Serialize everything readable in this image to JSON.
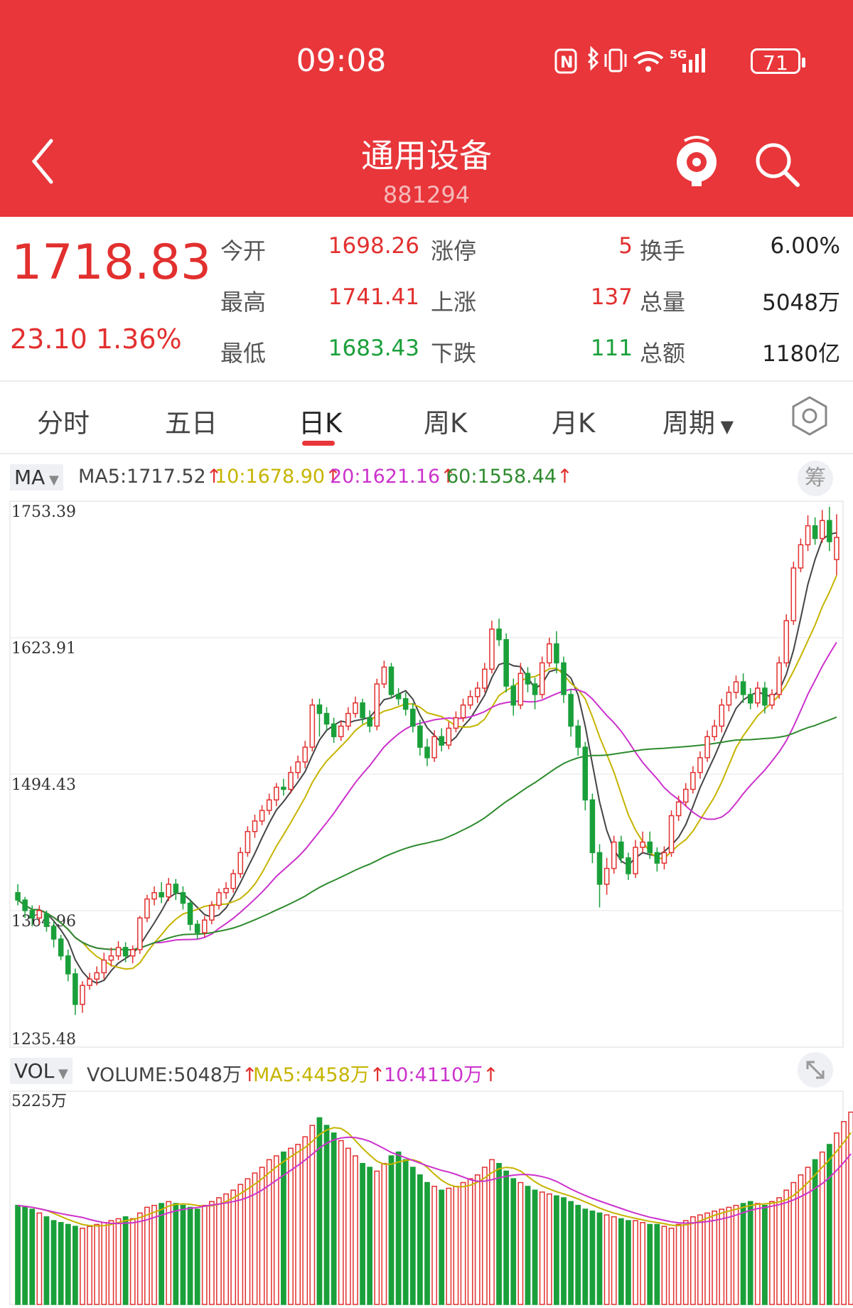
{
  "status_bar": {
    "time": "09:08",
    "network": "5G",
    "battery": "71"
  },
  "header": {
    "title": "通用设备",
    "code": "881294",
    "back_icon": "chevron-left-icon",
    "robot_icon": "robot-assistant-icon",
    "search_icon": "search-icon"
  },
  "quote": {
    "price": "1718.83",
    "change": "23.10",
    "change_pct": "1.36%",
    "rows": [
      {
        "l1": "今开",
        "v1": "1698.26",
        "l2": "涨停",
        "v2": "5",
        "l3": "换手",
        "v3": "6.00%"
      },
      {
        "l1": "最高",
        "v1": "1741.41",
        "l2": "上涨",
        "v2": "137",
        "l3": "总量",
        "v3": "5048万"
      },
      {
        "l1": "最低",
        "v1": "1683.43",
        "l2": "下跌",
        "v2": "111",
        "l3": "总额",
        "v3": "1180亿"
      }
    ]
  },
  "tabs": [
    {
      "label": "分时"
    },
    {
      "label": "五日"
    },
    {
      "label": "日K",
      "active": true
    },
    {
      "label": "周K"
    },
    {
      "label": "月K"
    },
    {
      "label": "周期"
    }
  ],
  "settings_icon": "hexagon-settings-icon",
  "ma_legend": {
    "selector": "MA",
    "items": [
      {
        "text": "MA5:1717.52",
        "color": "#444444"
      },
      {
        "text": "10:1678.90",
        "color": "#c6b400"
      },
      {
        "text": "20:1621.16",
        "color": "#cc33cc"
      },
      {
        "text": "60:1558.44",
        "color": "#2e8b2e"
      }
    ],
    "chou_label": "筹"
  },
  "vol_legend": {
    "selector": "VOL",
    "items": [
      {
        "text": "VOLUME:5048万",
        "color": "#444444"
      },
      {
        "text": "MA5:4458万",
        "color": "#c6b400"
      },
      {
        "text": "10:4110万",
        "color": "#cc33cc"
      }
    ],
    "expand_icon": "expand-icon"
  },
  "chart_data": {
    "type": "candlestick",
    "y_ticks": [
      "1753.39",
      "1623.91",
      "1494.43",
      "1364.96",
      "1235.48"
    ],
    "ylim": [
      1235.48,
      1753.39
    ],
    "volume_max_label": "5225万",
    "volume_max": 5225,
    "colors": {
      "up": "#e2302f",
      "down": "#1aa03a",
      "ma5": "#444444",
      "ma10": "#c6b400",
      "ma20": "#cc33cc",
      "ma60": "#2e8b2e"
    },
    "candles": [
      [
        1382,
        1375,
        1390,
        1370
      ],
      [
        1375,
        1365,
        1378,
        1358
      ],
      [
        1365,
        1358,
        1370,
        1350
      ],
      [
        1358,
        1365,
        1370,
        1352
      ],
      [
        1362,
        1350,
        1365,
        1345
      ],
      [
        1350,
        1338,
        1355,
        1330
      ],
      [
        1338,
        1322,
        1342,
        1318
      ],
      [
        1322,
        1305,
        1328,
        1298
      ],
      [
        1305,
        1276,
        1310,
        1266
      ],
      [
        1276,
        1294,
        1298,
        1268
      ],
      [
        1294,
        1300,
        1306,
        1290
      ],
      [
        1300,
        1306,
        1312,
        1294
      ],
      [
        1306,
        1318,
        1325,
        1300
      ],
      [
        1318,
        1322,
        1330,
        1312
      ],
      [
        1322,
        1330,
        1336,
        1318
      ],
      [
        1330,
        1322,
        1335,
        1316
      ],
      [
        1322,
        1328,
        1332,
        1315
      ],
      [
        1328,
        1358,
        1360,
        1324
      ],
      [
        1358,
        1376,
        1380,
        1354
      ],
      [
        1376,
        1382,
        1388,
        1370
      ],
      [
        1382,
        1378,
        1392,
        1372
      ],
      [
        1378,
        1390,
        1396,
        1374
      ],
      [
        1390,
        1382,
        1395,
        1375
      ],
      [
        1382,
        1372,
        1388,
        1366
      ],
      [
        1372,
        1352,
        1376,
        1346
      ],
      [
        1352,
        1344,
        1356,
        1338
      ],
      [
        1344,
        1356,
        1360,
        1340
      ],
      [
        1356,
        1370,
        1374,
        1352
      ],
      [
        1370,
        1382,
        1386,
        1366
      ],
      [
        1382,
        1386,
        1392,
        1376
      ],
      [
        1386,
        1400,
        1404,
        1382
      ],
      [
        1400,
        1420,
        1425,
        1396
      ],
      [
        1420,
        1440,
        1445,
        1416
      ],
      [
        1440,
        1450,
        1456,
        1434
      ],
      [
        1450,
        1460,
        1465,
        1446
      ],
      [
        1460,
        1470,
        1476,
        1456
      ],
      [
        1470,
        1482,
        1486,
        1464
      ],
      [
        1482,
        1480,
        1490,
        1474
      ],
      [
        1480,
        1496,
        1502,
        1476
      ],
      [
        1496,
        1506,
        1512,
        1490
      ],
      [
        1506,
        1520,
        1526,
        1500
      ],
      [
        1520,
        1560,
        1566,
        1516
      ],
      [
        1560,
        1552,
        1566,
        1530
      ],
      [
        1552,
        1542,
        1558,
        1536
      ],
      [
        1542,
        1530,
        1548,
        1524
      ],
      [
        1530,
        1540,
        1545,
        1526
      ],
      [
        1540,
        1552,
        1558,
        1536
      ],
      [
        1552,
        1562,
        1568,
        1548
      ],
      [
        1562,
        1548,
        1566,
        1542
      ],
      [
        1548,
        1540,
        1555,
        1534
      ],
      [
        1540,
        1580,
        1585,
        1536
      ],
      [
        1580,
        1596,
        1602,
        1576
      ],
      [
        1596,
        1570,
        1600,
        1566
      ],
      [
        1570,
        1566,
        1576,
        1560
      ],
      [
        1566,
        1556,
        1572,
        1550
      ],
      [
        1556,
        1540,
        1562,
        1534
      ],
      [
        1540,
        1520,
        1546,
        1512
      ],
      [
        1520,
        1510,
        1528,
        1502
      ],
      [
        1510,
        1530,
        1536,
        1506
      ],
      [
        1530,
        1522,
        1538,
        1516
      ],
      [
        1522,
        1538,
        1544,
        1518
      ],
      [
        1538,
        1548,
        1554,
        1534
      ],
      [
        1548,
        1560,
        1566,
        1544
      ],
      [
        1560,
        1568,
        1574,
        1556
      ],
      [
        1568,
        1576,
        1582,
        1562
      ],
      [
        1576,
        1594,
        1600,
        1572
      ],
      [
        1594,
        1632,
        1640,
        1590
      ],
      [
        1632,
        1622,
        1642,
        1616
      ],
      [
        1622,
        1578,
        1628,
        1572
      ],
      [
        1578,
        1560,
        1585,
        1550
      ],
      [
        1560,
        1590,
        1600,
        1556
      ],
      [
        1590,
        1580,
        1596,
        1572
      ],
      [
        1580,
        1570,
        1586,
        1556
      ],
      [
        1570,
        1600,
        1606,
        1566
      ],
      [
        1600,
        1618,
        1624,
        1596
      ],
      [
        1618,
        1600,
        1630,
        1590
      ],
      [
        1600,
        1570,
        1606,
        1562
      ],
      [
        1570,
        1540,
        1575,
        1530
      ],
      [
        1540,
        1520,
        1546,
        1512
      ],
      [
        1520,
        1470,
        1525,
        1460
      ],
      [
        1470,
        1420,
        1476,
        1410
      ],
      [
        1420,
        1390,
        1428,
        1368
      ],
      [
        1390,
        1405,
        1415,
        1380
      ],
      [
        1405,
        1430,
        1436,
        1400
      ],
      [
        1430,
        1415,
        1436,
        1410
      ],
      [
        1415,
        1400,
        1420,
        1394
      ],
      [
        1400,
        1425,
        1432,
        1396
      ],
      [
        1425,
        1430,
        1440,
        1420
      ],
      [
        1430,
        1420,
        1440,
        1414
      ],
      [
        1420,
        1410,
        1425,
        1402
      ],
      [
        1410,
        1420,
        1426,
        1404
      ],
      [
        1420,
        1455,
        1460,
        1416
      ],
      [
        1455,
        1468,
        1474,
        1450
      ],
      [
        1468,
        1480,
        1486,
        1464
      ],
      [
        1480,
        1496,
        1502,
        1476
      ],
      [
        1496,
        1510,
        1516,
        1490
      ],
      [
        1510,
        1530,
        1536,
        1506
      ],
      [
        1530,
        1540,
        1546,
        1526
      ],
      [
        1540,
        1560,
        1566,
        1534
      ],
      [
        1560,
        1572,
        1578,
        1554
      ],
      [
        1572,
        1582,
        1588,
        1566
      ],
      [
        1582,
        1570,
        1590,
        1562
      ],
      [
        1570,
        1562,
        1576,
        1556
      ],
      [
        1562,
        1576,
        1582,
        1558
      ],
      [
        1576,
        1560,
        1582,
        1552
      ],
      [
        1560,
        1570,
        1575,
        1556
      ],
      [
        1570,
        1600,
        1606,
        1566
      ],
      [
        1600,
        1640,
        1646,
        1596
      ],
      [
        1640,
        1690,
        1696,
        1636
      ],
      [
        1690,
        1712,
        1718,
        1686
      ],
      [
        1712,
        1730,
        1740,
        1706
      ],
      [
        1730,
        1718,
        1738,
        1712
      ],
      [
        1718,
        1735,
        1745,
        1714
      ],
      [
        1735,
        1715,
        1748,
        1706
      ],
      [
        1698,
        1719,
        1741,
        1683
      ]
    ],
    "volumes": [
      2600,
      2550,
      2500,
      2400,
      2300,
      2200,
      2150,
      2100,
      2050,
      2000,
      2050,
      2100,
      2150,
      2200,
      2250,
      2300,
      2250,
      2400,
      2550,
      2600,
      2650,
      2700,
      2650,
      2600,
      2550,
      2500,
      2600,
      2700,
      2800,
      2900,
      3000,
      3150,
      3300,
      3450,
      3600,
      3800,
      3900,
      4000,
      4100,
      4200,
      4400,
      4700,
      4900,
      4700,
      4500,
      4300,
      4100,
      3900,
      3700,
      3600,
      3500,
      3700,
      3900,
      4000,
      3800,
      3600,
      3400,
      3200,
      3100,
      3000,
      3050,
      3100,
      3200,
      3300,
      3400,
      3600,
      3800,
      3700,
      3500,
      3300,
      3200,
      3100,
      3000,
      2950,
      2900,
      2850,
      2800,
      2700,
      2600,
      2500,
      2450,
      2400,
      2350,
      2300,
      2250,
      2200,
      2200,
      2150,
      2100,
      2100,
      2050,
      2000,
      2100,
      2200,
      2300,
      2350,
      2400,
      2450,
      2500,
      2550,
      2600,
      2650,
      2700,
      2650,
      2600,
      2700,
      2800,
      3000,
      3200,
      3400,
      3600,
      3800,
      4000,
      4200,
      4500,
      4800,
      5048
    ]
  }
}
